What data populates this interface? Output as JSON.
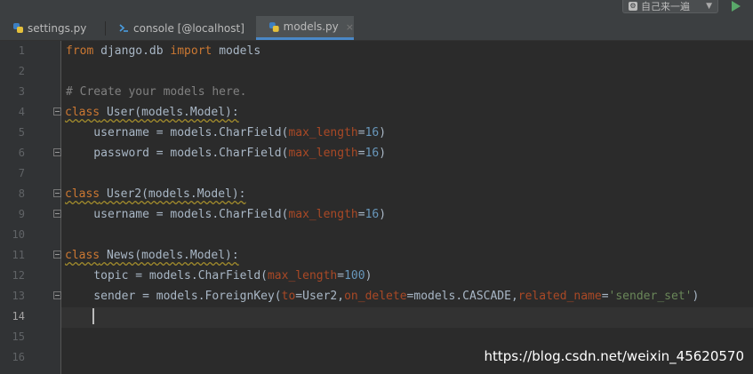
{
  "toolbar": {
    "run_config_label": "自己来一遍",
    "run_config_icon": "python-config-icon",
    "run_icon": "run-icon"
  },
  "tabs": [
    {
      "label": "settings.py",
      "icon": "python-file-icon",
      "active": false
    },
    {
      "label": "console [@localhost]",
      "icon": "console-icon",
      "active": false
    },
    {
      "label": "models.py",
      "icon": "python-file-icon",
      "active": true,
      "close": "×"
    }
  ],
  "editor": {
    "line_numbers": [
      "1",
      "2",
      "3",
      "4",
      "5",
      "6",
      "7",
      "8",
      "9",
      "10",
      "11",
      "12",
      "13",
      "14",
      "15",
      "16"
    ],
    "current_line": "14",
    "lines": {
      "l1": {
        "kw_from": "from",
        "module": " django.db ",
        "kw_import": "import",
        "name": " models"
      },
      "l3": {
        "comment": "# Create your models here."
      },
      "l4": {
        "kw": "class",
        "rest": " User(models.Model):"
      },
      "l5": {
        "pre": "    username = models.CharField(",
        "param": "max_length",
        "eq": "=",
        "num": "16",
        "post": ")"
      },
      "l6": {
        "pre": "    password = models.CharField(",
        "param": "max_length",
        "eq": "=",
        "num": "16",
        "post": ")"
      },
      "l8": {
        "kw": "class",
        "rest": " User2(models.Model):"
      },
      "l9": {
        "pre": "    username = models.CharField(",
        "param": "max_length",
        "eq": "=",
        "num": "16",
        "post": ")"
      },
      "l11": {
        "kw": "class",
        "rest": " News(models.Model):"
      },
      "l12": {
        "pre": "    topic = models.CharField(",
        "param": "max_length",
        "eq": "=",
        "num": "100",
        "post": ")"
      },
      "l13": {
        "pre": "    sender = models.ForeignKey(",
        "p1": "to",
        "v1": "=User2,",
        "p2": "on_delete",
        "v2": "=models.CASCADE,",
        "p3": "related_name",
        "eq3": "=",
        "str": "'sender_set'",
        "post": ")"
      }
    }
  },
  "watermark": "https://blog.csdn.net/weixin_45620570",
  "colors": {
    "background": "#2b2b2b",
    "keyword": "#cc7832",
    "comment": "#808080",
    "parameter": "#aa4926",
    "number": "#6897bb",
    "string": "#6a8759",
    "active_tab_underline": "#4a88c7"
  }
}
